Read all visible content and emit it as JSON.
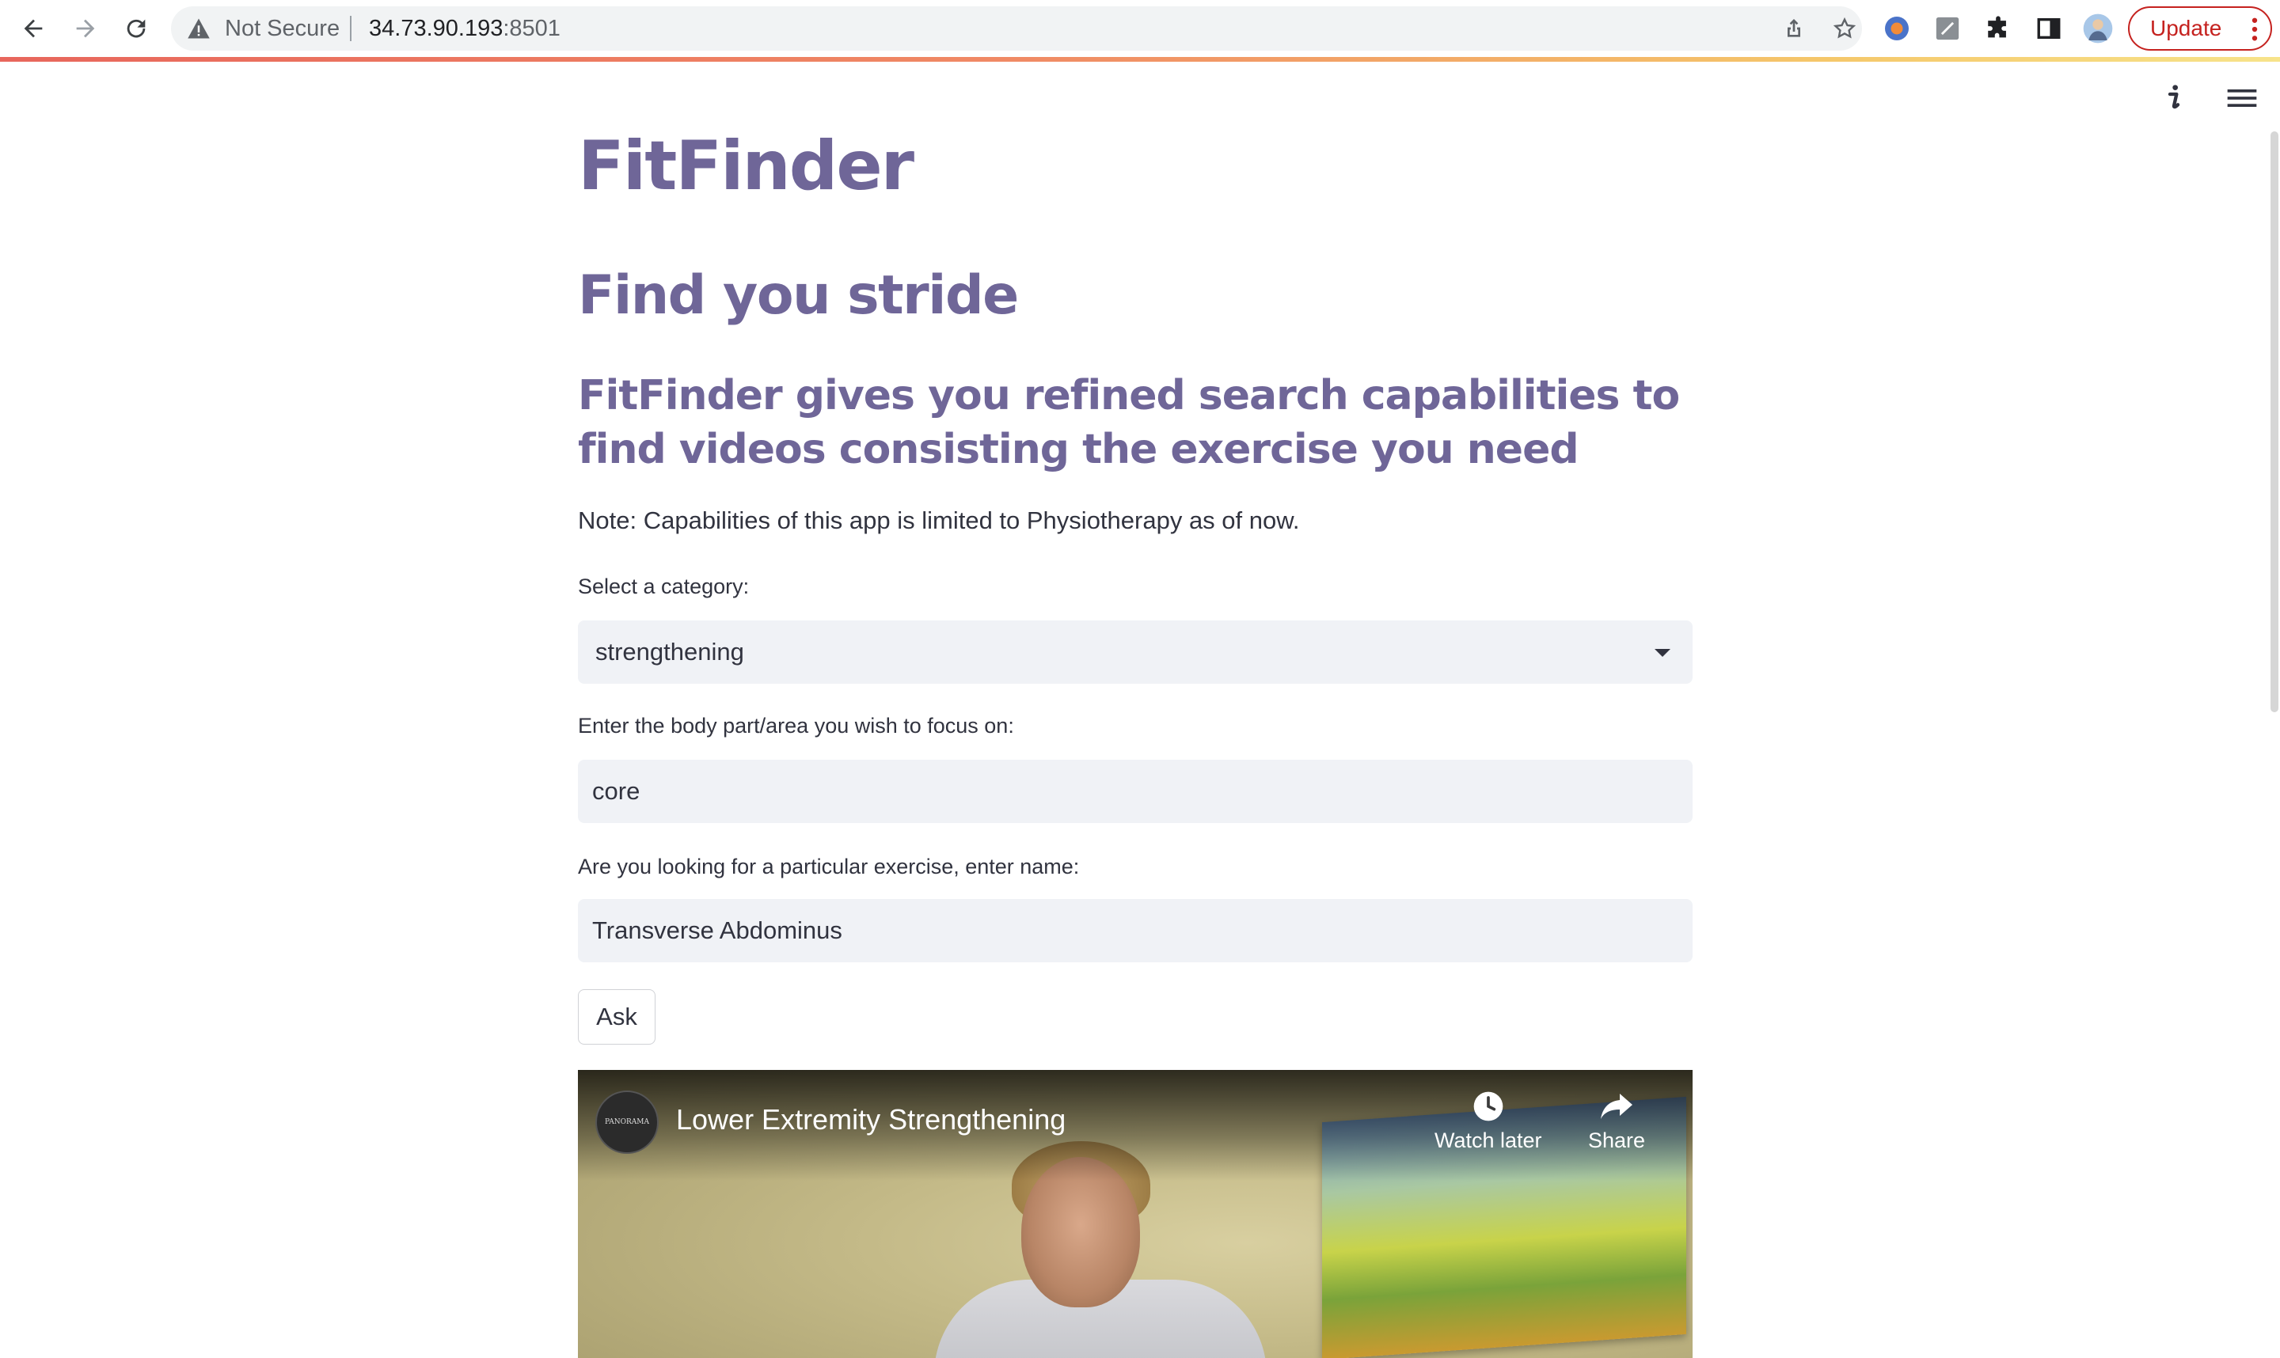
{
  "browser": {
    "security_label": "Not Secure",
    "url_host": "34.73.90.193",
    "url_port": ":8501",
    "update_label": "Update",
    "accent": "#c5221f"
  },
  "app": {
    "title": "FitFinder",
    "subtitle": "Find you stride",
    "lead": "FitFinder gives you refined search capabilities to find videos consisting the exercise you need",
    "note": "Note: Capabilities of this app is limited to Physiotherapy as of now.",
    "heading_color": "#6f6698"
  },
  "form": {
    "category_label": "Select a category:",
    "category_value": "strengthening",
    "body_part_label": "Enter the body part/area you wish to focus on:",
    "body_part_value": "core",
    "exercise_label": "Are you looking for a particular exercise, enter name:",
    "exercise_value": "Transverse Abdominus",
    "ask_label": "Ask"
  },
  "video": {
    "title": "Lower Extremity Strengthening",
    "channel_logo_text": "PANORAMA",
    "watch_later_label": "Watch later",
    "share_label": "Share"
  },
  "icons": {
    "back": "arrow-left-icon",
    "forward": "arrow-right-icon",
    "reload": "reload-icon",
    "warning": "warning-icon",
    "share": "share-icon",
    "bookmark": "star-icon",
    "extensions": "puzzle-icon",
    "side_panel": "side-panel-icon",
    "app_info": "info-icon",
    "app_menu": "hamburger-menu-icon"
  }
}
